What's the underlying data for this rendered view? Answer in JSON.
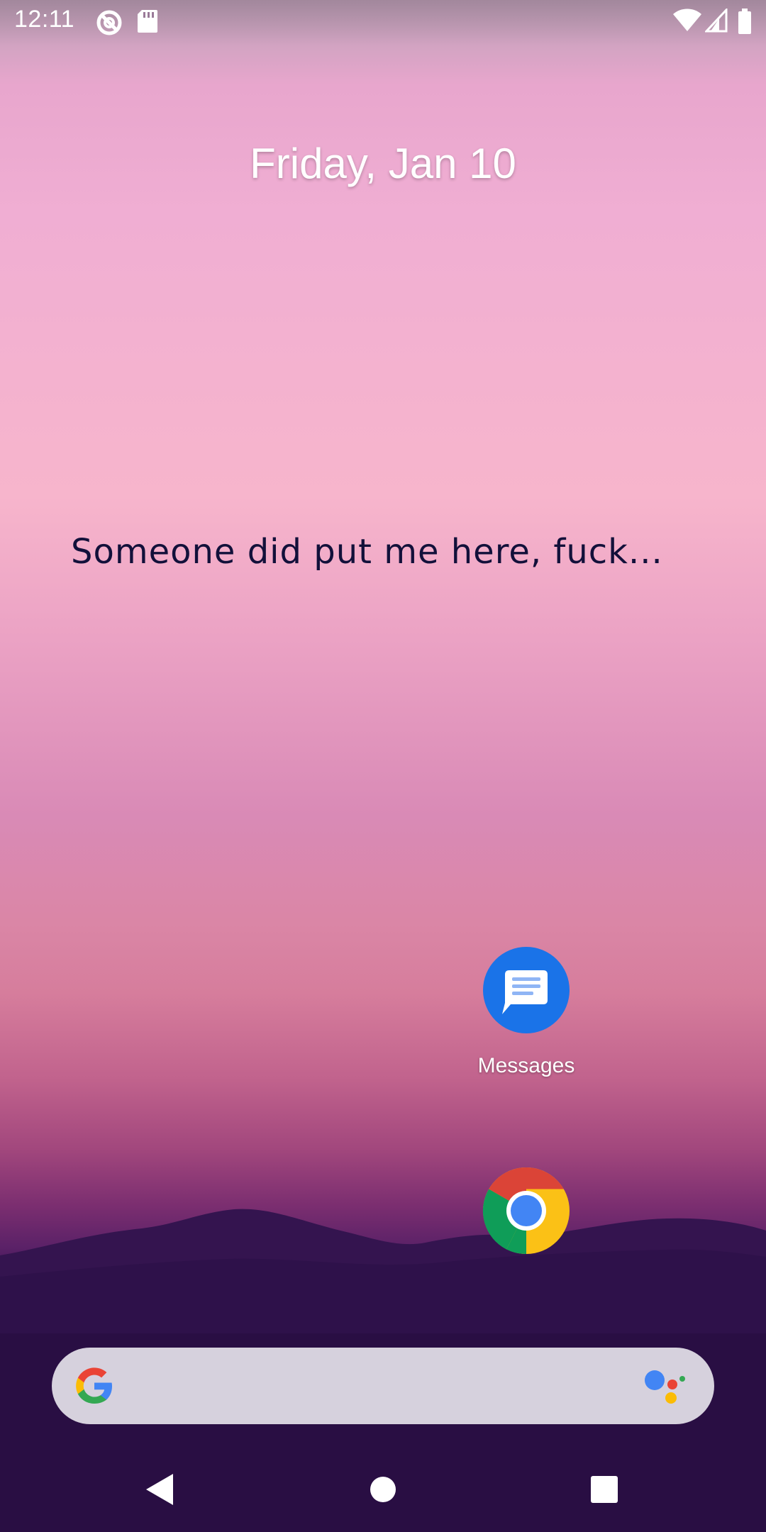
{
  "status_bar": {
    "time": "12:11",
    "left_icons": [
      "do-not-disturb-icon",
      "sd-card-icon"
    ],
    "right_icons": [
      "wifi-icon",
      "cell-signal-icon",
      "battery-icon"
    ]
  },
  "home": {
    "date": "Friday, Jan 10",
    "overlay_message": "Someone did put me here, fuck...",
    "apps": [
      {
        "label": "Messages",
        "icon": "messages-icon"
      },
      {
        "label": "",
        "icon": "chrome-icon"
      }
    ]
  },
  "search_bar": {
    "logo_icon": "google-g-icon",
    "assistant_icon": "google-assistant-icon"
  },
  "nav_bar": {
    "back": "back-icon",
    "home": "home-icon",
    "recents": "recents-icon"
  },
  "colors": {
    "messages_blue": "#1a73e8",
    "message_text": "#12103a",
    "search_bar_bg": "#d6d1dd"
  }
}
